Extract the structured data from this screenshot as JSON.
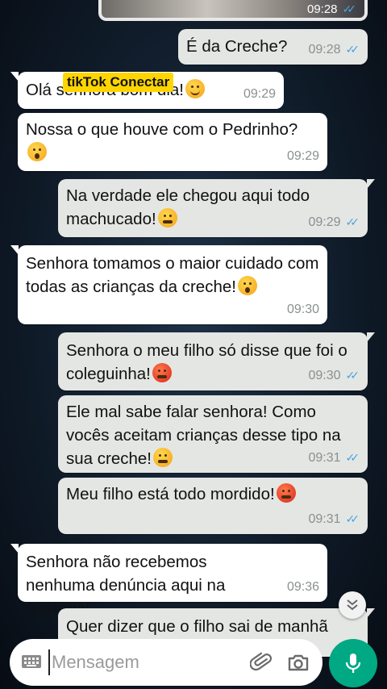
{
  "top_media": {
    "time": "09:28"
  },
  "watermark": "tikTok Conectar",
  "messages": [
    {
      "dir": "out",
      "text": "É da Creche?",
      "time": "09:28",
      "emoji": ""
    },
    {
      "dir": "in",
      "text": "Olá senhora bom dia!",
      "time": "09:29",
      "emoji": "smiling-face"
    },
    {
      "dir": "in",
      "text": "Nossa o que houve com o Pedrinho?",
      "time": "09:29",
      "emoji": "astonished-face"
    },
    {
      "dir": "out",
      "text": "Na verdade ele chegou aqui todo machucado!",
      "time": "09:29",
      "emoji": "steam-face"
    },
    {
      "dir": "in",
      "text": "Senhora tomamos o maior cuidado com todas as crianças da creche!",
      "time": "09:30",
      "emoji": "astonished-face"
    },
    {
      "dir": "out",
      "text": "Senhora o meu filho só disse que foi o coleguinha!",
      "time": "09:30",
      "emoji": "angry-face"
    },
    {
      "dir": "out",
      "text": "Ele mal sabe falar senhora! Como vocês aceitam crianças desse tipo na sua creche!",
      "time": "09:31",
      "emoji": "steam-face"
    },
    {
      "dir": "out",
      "text": "Meu filho está todo mordido!",
      "time": "09:31",
      "emoji": "pouting-face"
    },
    {
      "dir": "in",
      "text": "Senhora não recebemos nenhuma denúncia aqui na diretoria!",
      "time": "09:36",
      "emoji": ""
    },
    {
      "dir": "out",
      "text": "Quer dizer que o filho sai de manhã",
      "time": "",
      "emoji": ""
    }
  ],
  "composer": {
    "placeholder": "Mensagem"
  },
  "icons": {
    "keyboard": "keyboard-icon",
    "attach": "paperclip-icon",
    "camera": "camera-icon",
    "mic": "microphone-icon",
    "scroll": "double-chevron-down-icon",
    "read": "double-check-icon"
  },
  "colors": {
    "accent": "#00a884",
    "read_ticks": "#4aa3df",
    "incoming": "#ffffff",
    "outgoing": "#e4e6e4"
  }
}
